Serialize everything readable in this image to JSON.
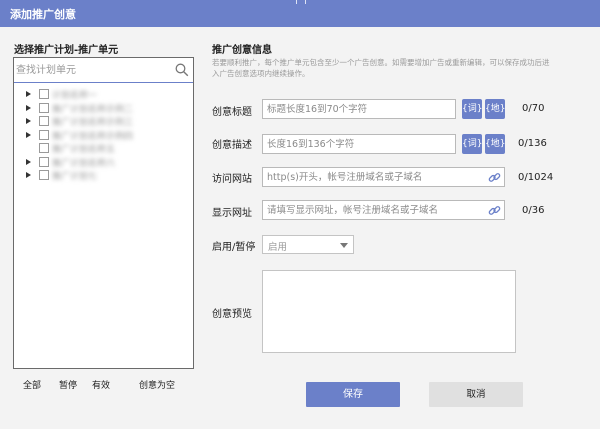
{
  "window": {
    "title": "添加推广创意"
  },
  "left_panel": {
    "title": "选择推广计划-推广单元",
    "search": {
      "placeholder": "查找计划单元",
      "value": ""
    },
    "tree": {
      "items": [
        {
          "label": "计划名称一",
          "has_children": true
        },
        {
          "label": "推广计划名称示例二",
          "has_children": true
        },
        {
          "label": "推广计划名称示例三",
          "has_children": true
        },
        {
          "label": "推广计划名称示例四",
          "has_children": true
        },
        {
          "label": "推广计划名称五",
          "has_children": false
        },
        {
          "label": "推广计划名称六",
          "has_children": true
        },
        {
          "label": "推广计划七",
          "has_children": true
        }
      ]
    },
    "footer": {
      "all": "全部",
      "paused": "暂停",
      "active": "有效",
      "empty_creative": "创意为空"
    }
  },
  "form": {
    "section_title": "推广创意信息",
    "note": "若要顺利推广，每个推广单元包含至少一个广告创意。如需要增加广告或重新编辑，可以保存成功后进入广告创意选项内继续操作。",
    "title_field": {
      "label": "创意标题",
      "placeholder": "标题长度16到70个字符",
      "value": "",
      "counter": "0/70",
      "btn_word": "{词}",
      "btn_place": "{地}"
    },
    "desc_field": {
      "label": "创意描述",
      "placeholder": "长度16到136个字符",
      "value": "",
      "counter": "0/136",
      "btn_word": "{词}",
      "btn_place": "{地}"
    },
    "visit_url": {
      "label": "访问网站",
      "placeholder": "http(s)开头，帐号注册域名或子域名",
      "value": "",
      "counter": "0/1024"
    },
    "display_url": {
      "label": "显示网址",
      "placeholder": "请填写显示网址，帐号注册域名或子域名",
      "value": "",
      "counter": "0/36"
    },
    "status": {
      "label": "启用/暂停",
      "selected": "启用"
    },
    "preview": {
      "label": "创意预览"
    }
  },
  "actions": {
    "save": "保存",
    "cancel": "取消"
  },
  "colors": {
    "accent": "#6b80c9",
    "button_secondary": "#e0e0e0",
    "background": "#f3f3f3"
  }
}
